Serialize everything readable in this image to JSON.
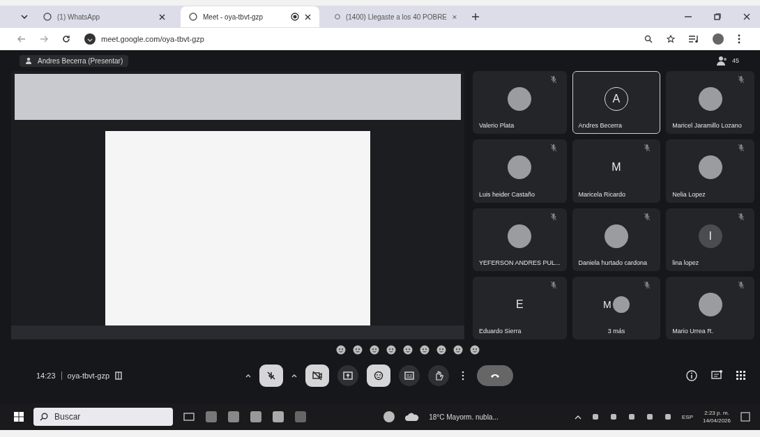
{
  "browser": {
    "tabs": [
      {
        "label": "(1) WhatsApp",
        "selected": false
      },
      {
        "label": "Meet - oya-tbvt-gzp",
        "selected": true,
        "recording": true
      },
      {
        "label": "(1400) Llegaste a los 40 POBRE",
        "selected": false
      }
    ],
    "url": "meet.google.com/oya-tbvt-gzp"
  },
  "meet": {
    "presenter_label": "Andres Becerra (Presentar)",
    "participant_count": "45",
    "participants": [
      {
        "name": "Valerio Plata",
        "kind": "photo",
        "selected": false
      },
      {
        "name": "Andres Becerra",
        "kind": "letter",
        "letter": "A",
        "selected": true
      },
      {
        "name": "Maricel Jaramillo Lozano",
        "kind": "photo",
        "selected": false
      },
      {
        "name": "Luis heider Castaño",
        "kind": "photo",
        "selected": false
      },
      {
        "name": "Maricela Ricardo",
        "kind": "letter",
        "letter": "M",
        "selected": false
      },
      {
        "name": "Nelia Lopez",
        "kind": "photo",
        "selected": false
      },
      {
        "name": "YEFERSON ANDRES PUL...",
        "kind": "photo",
        "selected": false
      },
      {
        "name": "Daniela hurtado cardona",
        "kind": "photo",
        "selected": false
      },
      {
        "name": "lina lopez",
        "kind": "letter",
        "letter": "I",
        "selected": false
      },
      {
        "name": "Eduardo Sierra",
        "kind": "letter",
        "letter": "E",
        "selected": false
      },
      {
        "name": "3 más",
        "kind": "group",
        "letter": "M",
        "selected": false
      },
      {
        "name": "Mario Urrea R.",
        "kind": "photo",
        "selected": false
      }
    ],
    "time": "14:23",
    "meeting_code": "oya-tbvt-gzp",
    "controls": [
      {
        "kind": "mic",
        "highlighted": true
      },
      {
        "kind": "camera",
        "highlighted": true
      },
      {
        "kind": "present",
        "highlighted": false
      },
      {
        "kind": "emoji",
        "highlighted": true
      },
      {
        "kind": "captions",
        "highlighted": false
      },
      {
        "kind": "hand",
        "highlighted": false
      },
      {
        "kind": "more",
        "highlighted": false
      },
      {
        "kind": "hangup",
        "highlighted": false
      }
    ]
  },
  "taskbar": {
    "search_placeholder": "Buscar",
    "weather": "18°C  Mayorm. nubla...",
    "language": "ESP",
    "clock": "2:23 p. m.",
    "date": "14/04/2026"
  }
}
